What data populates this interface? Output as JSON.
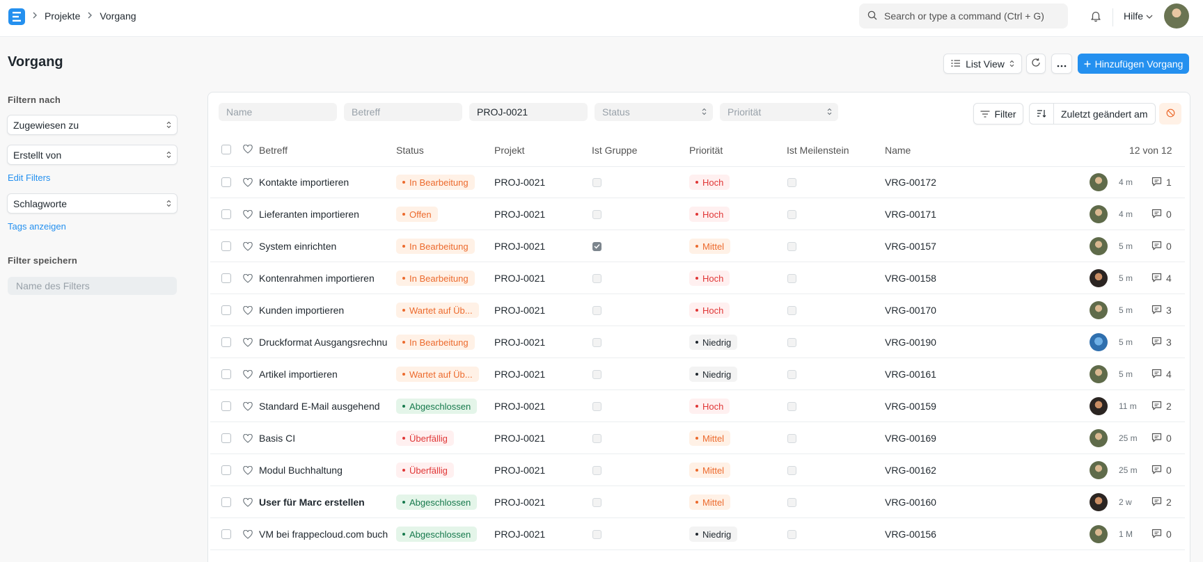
{
  "navbar": {
    "breadcrumbs": [
      "Projekte",
      "Vorgang"
    ],
    "search_placeholder": "Search or type a command (Ctrl + G)",
    "help_label": "Hilfe"
  },
  "page": {
    "title": "Vorgang",
    "view_label": "List View",
    "add_label": "Hinzufügen Vorgang"
  },
  "sidebar": {
    "filter_heading": "Filtern nach",
    "assigned_to": "Zugewiesen zu",
    "created_by": "Erstellt von",
    "edit_filters": "Edit Filters",
    "tags": "Schlagworte",
    "show_tags": "Tags anzeigen",
    "save_filter_heading": "Filter speichern",
    "filter_name_placeholder": "Name des Filters"
  },
  "filters": {
    "name_placeholder": "Name",
    "subject_placeholder": "Betreff",
    "project_value": "PROJ-0021",
    "status_placeholder": "Status",
    "priority_placeholder": "Priorität",
    "filter_label": "Filter",
    "sort_label": "Zuletzt geändert am"
  },
  "table": {
    "columns": {
      "subject": "Betreff",
      "status": "Status",
      "project": "Projekt",
      "is_group": "Ist Gruppe",
      "priority": "Priorität",
      "is_milestone": "Ist Meilenstein",
      "name": "Name"
    },
    "count": "12 von 12",
    "rows": [
      {
        "subject": "Kontakte importieren",
        "status": "In Bearbeitung",
        "status_color": "orange",
        "project": "PROJ-0021",
        "is_group": false,
        "priority": "Hoch",
        "priority_color": "red",
        "name": "VRG-00172",
        "avatar": "a",
        "time": "4 m",
        "comments": "1"
      },
      {
        "subject": "Lieferanten importieren",
        "status": "Offen",
        "status_color": "orange",
        "project": "PROJ-0021",
        "is_group": false,
        "priority": "Hoch",
        "priority_color": "red",
        "name": "VRG-00171",
        "avatar": "a",
        "time": "4 m",
        "comments": "0"
      },
      {
        "subject": "System einrichten",
        "status": "In Bearbeitung",
        "status_color": "orange",
        "project": "PROJ-0021",
        "is_group": true,
        "priority": "Mittel",
        "priority_color": "orange",
        "name": "VRG-00157",
        "avatar": "a",
        "time": "5 m",
        "comments": "0"
      },
      {
        "subject": "Kontenrahmen importieren",
        "status": "In Bearbeitung",
        "status_color": "orange",
        "project": "PROJ-0021",
        "is_group": false,
        "priority": "Hoch",
        "priority_color": "red",
        "name": "VRG-00158",
        "avatar": "b",
        "time": "5 m",
        "comments": "4"
      },
      {
        "subject": "Kunden importieren",
        "status": "Wartet auf Üb...",
        "status_color": "orange",
        "project": "PROJ-0021",
        "is_group": false,
        "priority": "Hoch",
        "priority_color": "red",
        "name": "VRG-00170",
        "avatar": "a",
        "time": "5 m",
        "comments": "3"
      },
      {
        "subject": "Druckformat Ausgangsrechnu",
        "status": "In Bearbeitung",
        "status_color": "orange",
        "project": "PROJ-0021",
        "is_group": false,
        "priority": "Niedrig",
        "priority_color": "gray",
        "name": "VRG-00190",
        "avatar": "c",
        "time": "5 m",
        "comments": "3"
      },
      {
        "subject": "Artikel importieren",
        "status": "Wartet auf Üb...",
        "status_color": "orange",
        "project": "PROJ-0021",
        "is_group": false,
        "priority": "Niedrig",
        "priority_color": "gray",
        "name": "VRG-00161",
        "avatar": "a",
        "time": "5 m",
        "comments": "4"
      },
      {
        "subject": "Standard E-Mail ausgehend",
        "status": "Abgeschlossen",
        "status_color": "green",
        "project": "PROJ-0021",
        "is_group": false,
        "priority": "Hoch",
        "priority_color": "red",
        "name": "VRG-00159",
        "avatar": "b",
        "time": "11 m",
        "comments": "2"
      },
      {
        "subject": "Basis CI",
        "status": "Überfällig",
        "status_color": "red",
        "project": "PROJ-0021",
        "is_group": false,
        "priority": "Mittel",
        "priority_color": "orange",
        "name": "VRG-00169",
        "avatar": "a",
        "time": "25 m",
        "comments": "0"
      },
      {
        "subject": "Modul Buchhaltung",
        "status": "Überfällig",
        "status_color": "red",
        "project": "PROJ-0021",
        "is_group": false,
        "priority": "Mittel",
        "priority_color": "orange",
        "name": "VRG-00162",
        "avatar": "a",
        "time": "25 m",
        "comments": "0"
      },
      {
        "subject": "User für Marc erstellen",
        "status": "Abgeschlossen",
        "status_color": "green",
        "project": "PROJ-0021",
        "is_group": false,
        "priority": "Mittel",
        "priority_color": "orange",
        "name": "VRG-00160",
        "avatar": "b",
        "time": "2 w",
        "comments": "2",
        "bold": true
      },
      {
        "subject": "VM bei frappecloud.com buch",
        "status": "Abgeschlossen",
        "status_color": "green",
        "project": "PROJ-0021",
        "is_group": false,
        "priority": "Niedrig",
        "priority_color": "gray",
        "name": "VRG-00156",
        "avatar": "a",
        "time": "1 M",
        "comments": "0"
      }
    ]
  },
  "colors": {
    "primary": "#2490ef",
    "orange": "#ec6a2d",
    "red": "#e03636",
    "green": "#16794c"
  },
  "icons": [
    "app-logo-icon",
    "chevron-right-icon",
    "search-icon",
    "bell-icon",
    "chevron-down-icon",
    "list-icon",
    "sort-updown-icon",
    "refresh-icon",
    "more-icon",
    "plus-icon",
    "filter-icon",
    "sort-icon",
    "remove-sort-icon",
    "heart-icon",
    "comment-icon",
    "check-icon"
  ]
}
